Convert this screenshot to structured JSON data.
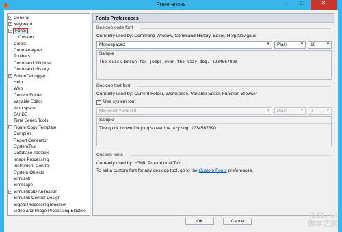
{
  "window": {
    "title": "Preferences",
    "controls": {
      "minimize": "–",
      "maximize": "□",
      "close": "✕"
    }
  },
  "sidebar": {
    "items": [
      {
        "label": "General",
        "expandable": true
      },
      {
        "label": "Keyboard",
        "expandable": true
      },
      {
        "label": "Fonts",
        "expandable": true,
        "selected": true,
        "expanded": true
      },
      {
        "label": "Custom",
        "child": true
      },
      {
        "label": "Colors"
      },
      {
        "label": "Code Analyzer"
      },
      {
        "label": "Toolbars"
      },
      {
        "label": "Command Window"
      },
      {
        "label": "Command History"
      },
      {
        "label": "Editor/Debugger",
        "expandable": true
      },
      {
        "label": "Help"
      },
      {
        "label": "Web"
      },
      {
        "label": "Current Folder"
      },
      {
        "label": "Variable Editor"
      },
      {
        "label": "Workspace"
      },
      {
        "label": "GUIDE"
      },
      {
        "label": "Time Series Tools"
      },
      {
        "label": "Figure Copy Template",
        "expandable": true
      },
      {
        "label": "Compiler"
      },
      {
        "label": "Report Generator"
      },
      {
        "label": "SystemTest"
      },
      {
        "label": "Database Toolbox"
      },
      {
        "label": "Image Processing"
      },
      {
        "label": "Instrument Control"
      },
      {
        "label": "System Objects"
      },
      {
        "label": "Simulink"
      },
      {
        "label": "Simscape"
      },
      {
        "label": "Simulink 3D Animation",
        "expandable": true
      },
      {
        "label": "Simulink Control Design"
      },
      {
        "label": "Signal Processing Blockset"
      },
      {
        "label": "Video and Image Processing Blockse"
      }
    ]
  },
  "panel": {
    "title": "Fonts Preferences",
    "desktop_code_font": {
      "heading": "Desktop code font",
      "used_by": "Currently used by: Command Window, Command History, Editor, Help Navigator",
      "font": "Monospaced",
      "style": "Plain",
      "size": "10",
      "sample_label": "Sample",
      "sample_text": "The quick brown fox jumps over the lazy dog.  1234567890"
    },
    "desktop_text_font": {
      "heading": "Desktop text font",
      "used_by": "Currently used by: Current Folder, Workspace, Variable Editor, Function Browser",
      "use_system_font_label": "Use system font",
      "use_system_font_checked": true,
      "font": "Microsoft YaHei UI",
      "style": "Plain",
      "size": "9",
      "sample_label": "Sample",
      "sample_text": "The quick brown fox jumps over the lazy dog.  1234567890"
    },
    "custom_fonts": {
      "heading": "Custom fonts",
      "used_by": "Currently used by: HTML Proportional Text",
      "instruction_prefix": "To set a custom font for any desktop tool, go to the",
      "link_text": "Custom Fonts",
      "instruction_suffix": "preferences."
    }
  },
  "buttons": {
    "ok": "OK",
    "cancel": "Cance"
  },
  "watermark": {
    "line1": "jb51.net",
    "line2": "脚本之家"
  },
  "colors": {
    "titlebar": "#38b6eb",
    "close_button": "#c7352d",
    "selection_outline": "#d53131",
    "link": "#0b55c4"
  }
}
